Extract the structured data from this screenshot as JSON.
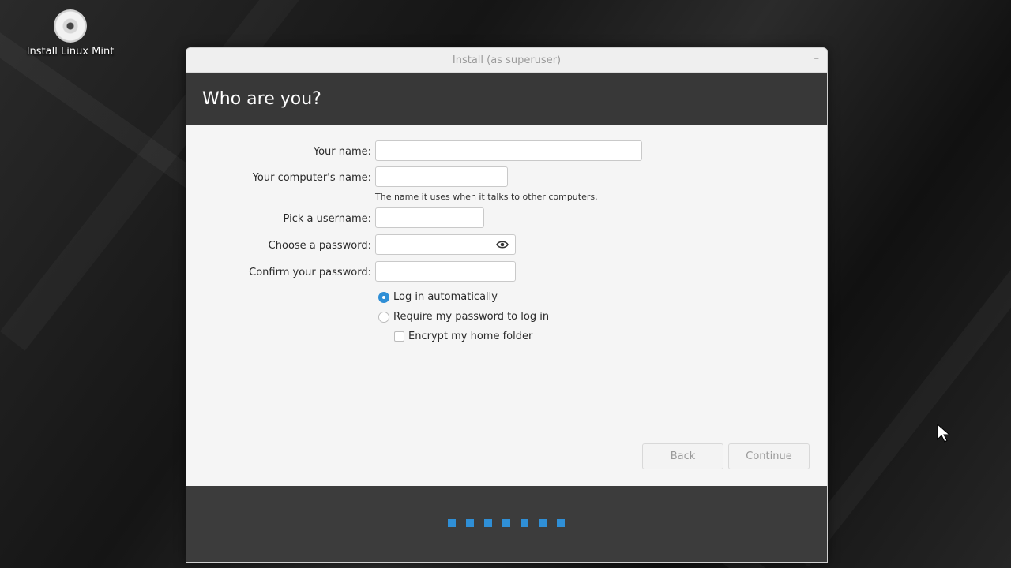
{
  "desktop": {
    "icon_label": "Install Linux Mint",
    "icon_name": "disc-icon"
  },
  "window": {
    "title": "Install (as superuser)",
    "minimize_symbol": "–"
  },
  "page": {
    "heading": "Who are you?"
  },
  "form": {
    "name_label": "Your name:",
    "name_value": "",
    "computer_label": "Your computer's name:",
    "computer_value": "",
    "computer_hint": "The name it uses when it talks to other computers.",
    "username_label": "Pick a username:",
    "username_value": "",
    "password_label": "Choose a password:",
    "password_value": "",
    "confirm_label": "Confirm your password:",
    "confirm_value": "",
    "login_auto_label": "Log in automatically",
    "login_auto_selected": true,
    "require_password_label": "Require my password to log in",
    "require_password_selected": false,
    "encrypt_label": "Encrypt my home folder",
    "encrypt_checked": false
  },
  "buttons": {
    "back": "Back",
    "continue": "Continue"
  },
  "progress": {
    "steps_total": 7,
    "accent_color": "#2f8fd6"
  }
}
